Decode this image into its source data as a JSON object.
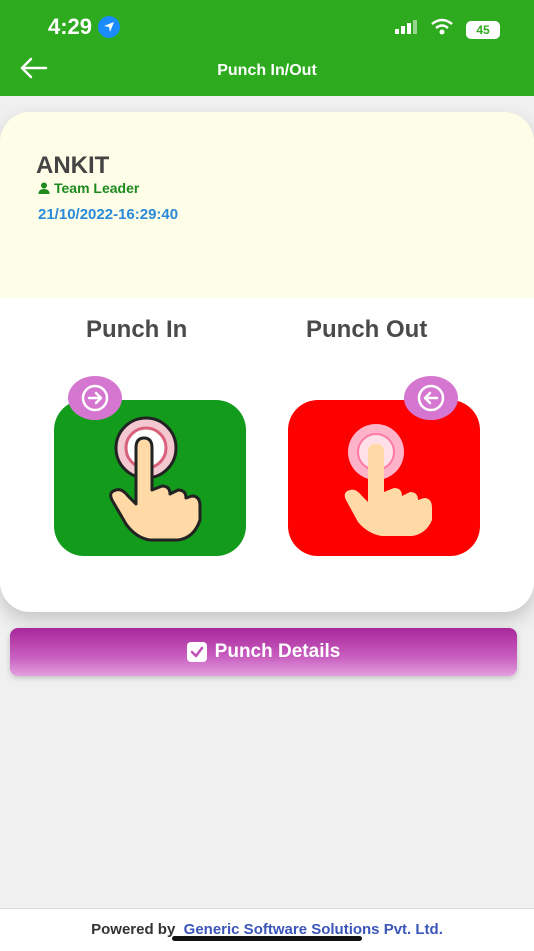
{
  "status_bar": {
    "time": "4:29",
    "battery": "45"
  },
  "header": {
    "title": "Punch In/Out"
  },
  "employee": {
    "name": "ANKIT",
    "role": "Team Leader",
    "datetime": "21/10/2022-16:29:40"
  },
  "punch": {
    "in_label": "Punch In",
    "out_label": "Punch Out"
  },
  "details_button": {
    "label": "Punch Details"
  },
  "footer": {
    "powered_by": "Powered by",
    "company": "Generic Software Solutions Pvt. Ltd."
  },
  "colors": {
    "header": "#2eaa1e",
    "punch_in": "#139b1c",
    "punch_out": "#ff0000",
    "details": "#b83cae",
    "badge": "#d577d0"
  }
}
